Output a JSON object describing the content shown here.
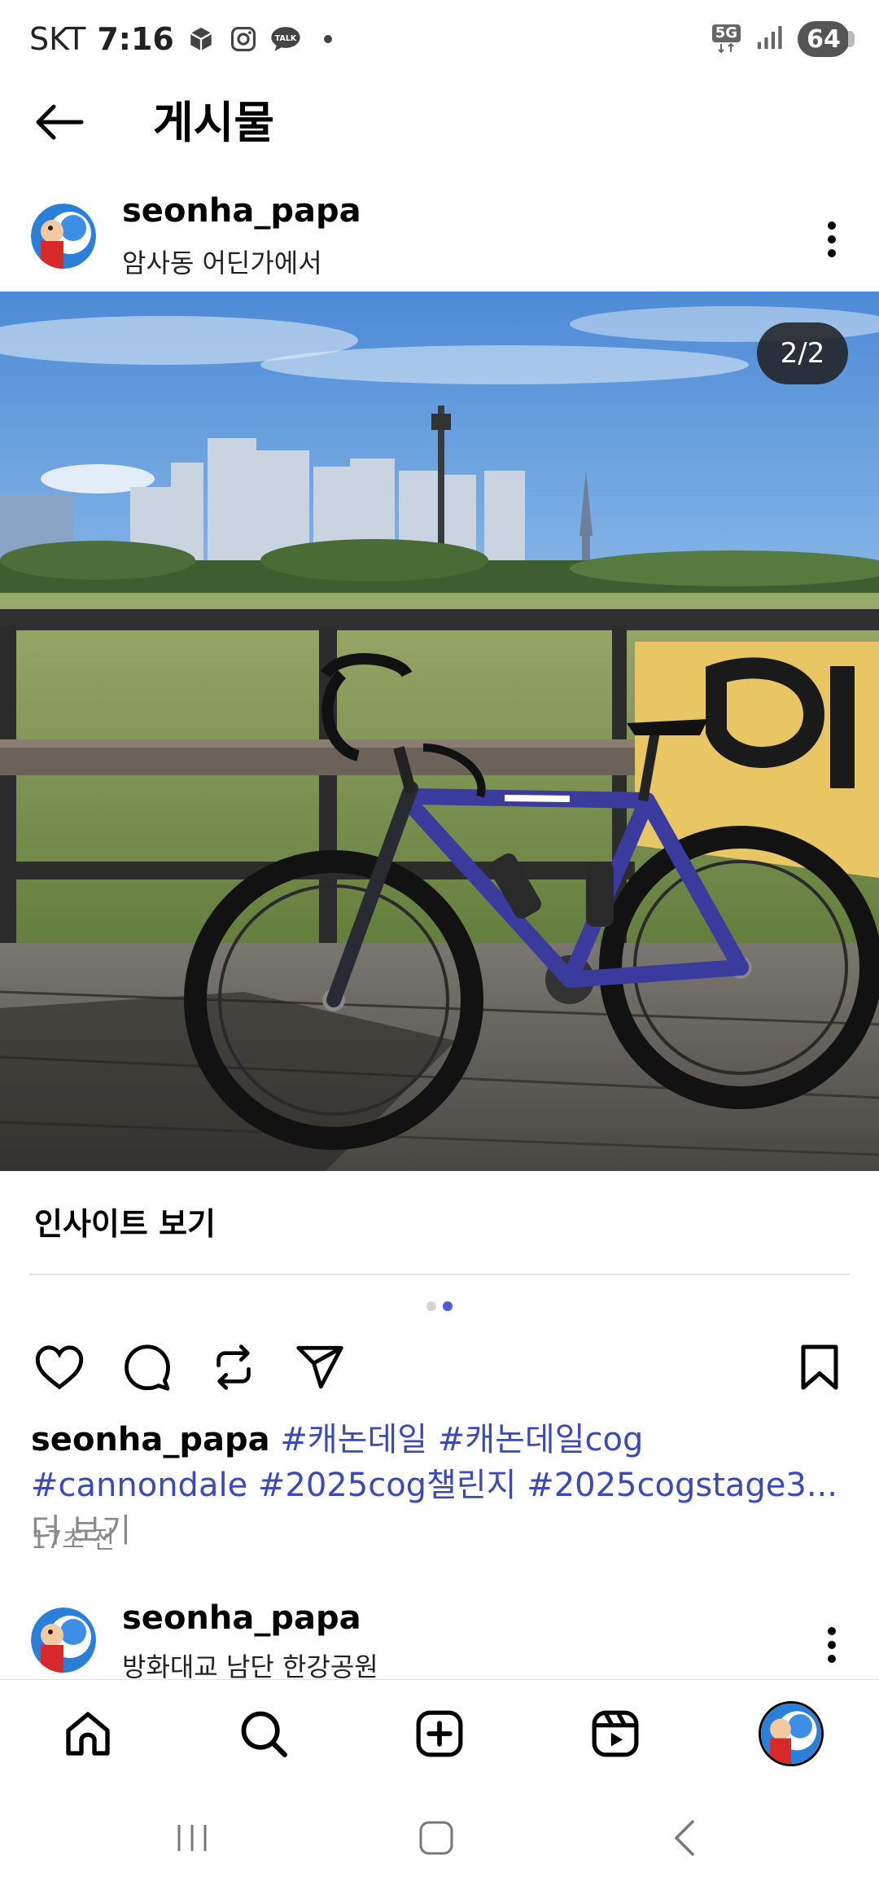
{
  "status_bar": {
    "carrier": "SKT",
    "time": "7:16",
    "network": "5G",
    "battery": "64",
    "icons": [
      "box-app-icon",
      "instagram-icon",
      "kakaotalk-icon",
      "signal-icon"
    ]
  },
  "header": {
    "title": "게시물",
    "back_icon": "arrow-left-icon"
  },
  "post": {
    "username": "seonha_papa",
    "location": "암사동 어딘가에서",
    "page_counter": "2/2",
    "insights_label": "인사이트 보기",
    "carousel": {
      "total": 2,
      "active": 2
    },
    "caption_user": "seonha_papa",
    "hashtags": [
      "#캐논데일",
      "#캐논데일cog",
      "#cannondale",
      "#2025cog챌린지",
      "#2025cogstage3"
    ],
    "ellipsis": "...",
    "more_label": "더 보기",
    "time_ago": "17초 전"
  },
  "next_post": {
    "username": "seonha_papa",
    "location": "방화대교 남단 한강공원"
  },
  "actions": [
    "heart-icon",
    "comment-icon",
    "repost-icon",
    "share-icon",
    "bookmark-icon"
  ],
  "bottom_nav": [
    "home-icon",
    "search-icon",
    "create-icon",
    "reels-icon",
    "profile-avatar"
  ],
  "colors": {
    "hashtag": "#3a4ab8",
    "accent_dot": "#4f5bd5",
    "banner_yellow": "#e8c664"
  }
}
